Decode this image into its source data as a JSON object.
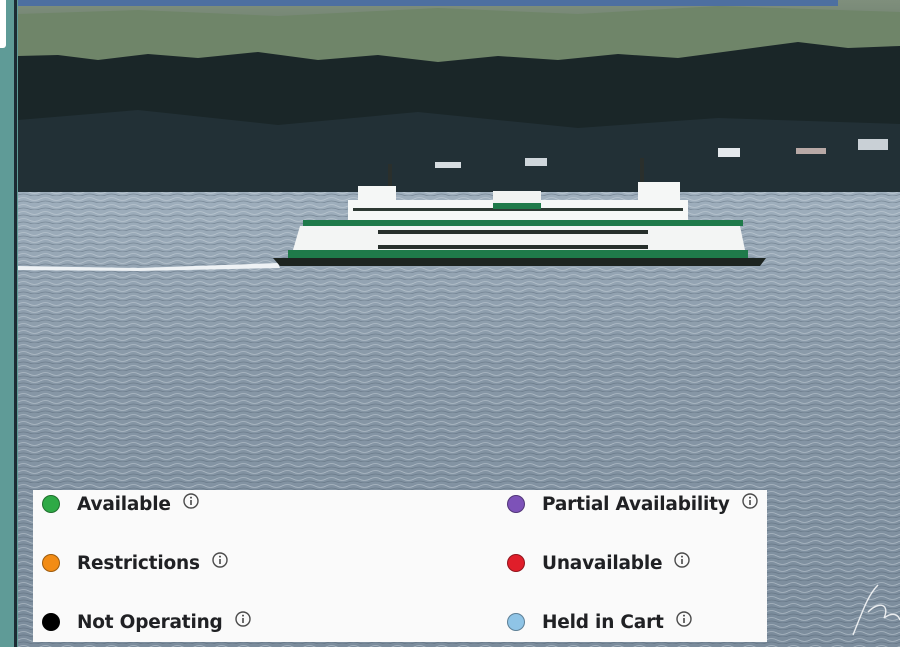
{
  "legend": {
    "items": [
      {
        "label": "Available",
        "color": "#2eaa46"
      },
      {
        "label": "Partial Availability",
        "color": "#7d52b8"
      },
      {
        "label": "Restrictions",
        "color": "#f28c15"
      },
      {
        "label": "Unavailable",
        "color": "#e01e2a"
      },
      {
        "label": "Not Operating",
        "color": "#000000"
      },
      {
        "label": "Held in Cart",
        "color": "#8fc4e6"
      }
    ],
    "info_icon": "info-circle-icon"
  },
  "photo": {
    "subject": "ferry-on-water",
    "signature_text": "Ker"
  }
}
